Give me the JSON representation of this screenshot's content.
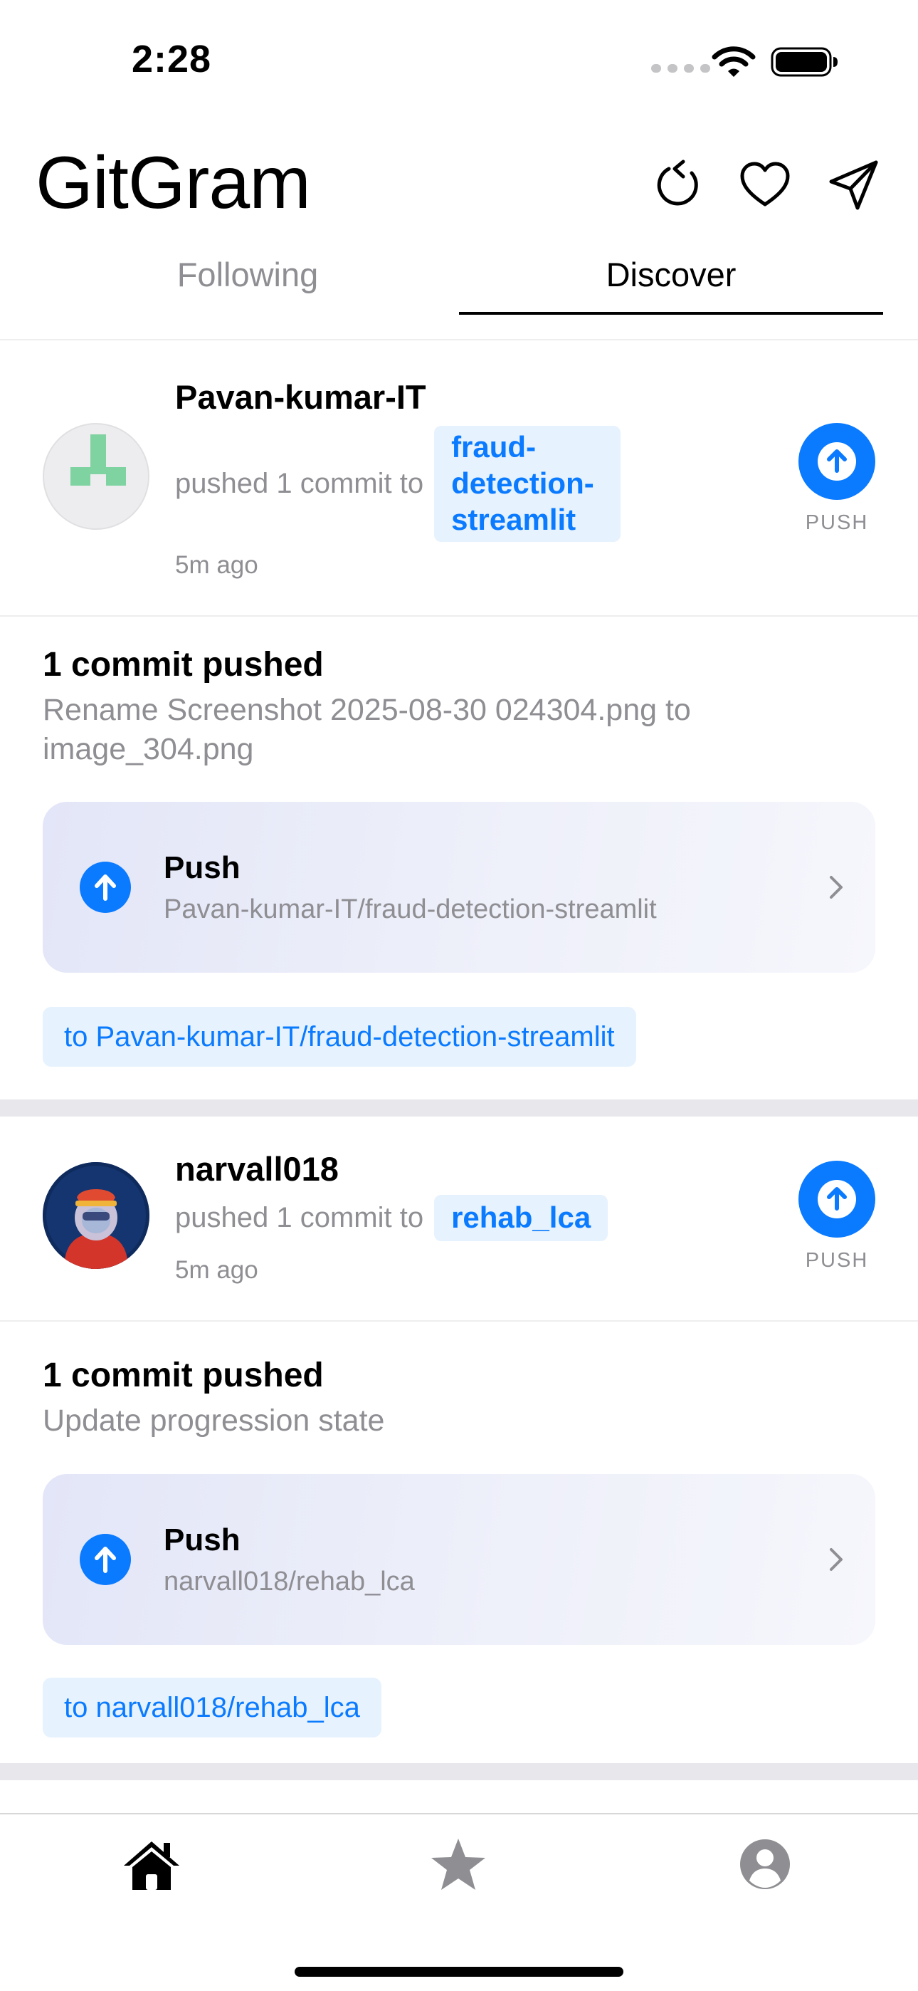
{
  "status_bar": {
    "time": "2:28"
  },
  "header": {
    "title": "GitGram"
  },
  "tabs": {
    "following": "Following",
    "discover": "Discover"
  },
  "posts": [
    {
      "username": "Pavan-kumar-IT",
      "action": "pushed 1 commit to",
      "repo_chip": "fraud-\ndetection-\nstreamlit",
      "time": "5m ago",
      "push_label": "PUSH",
      "commit_title": "1 commit pushed",
      "commit_message": "Rename Screenshot 2025-08-30 024304.png to image_304.png",
      "event_label": "Push",
      "event_repo": "Pavan-kumar-IT/fraud-detection-streamlit",
      "to_chip": "to Pavan-kumar-IT/fraud-detection-streamlit"
    },
    {
      "username": "narvall018",
      "action": "pushed 1 commit to",
      "repo_chip": "rehab_lca",
      "time": "5m ago",
      "push_label": "PUSH",
      "commit_title": "1 commit pushed",
      "commit_message": "Update progression state",
      "event_label": "Push",
      "event_repo": "narvall018/rehab_lca",
      "to_chip": "to narvall018/rehab_lca"
    }
  ],
  "icons": {
    "refresh": "refresh-icon",
    "heart": "heart-icon",
    "send": "send-icon",
    "push": "arrow-up-circle-icon",
    "chevron": "chevron-right-icon",
    "home": "home-icon",
    "star": "star-icon",
    "profile": "person-circle-icon"
  },
  "colors": {
    "accent": "#0a7aff",
    "secondary_text": "#8e8e93",
    "chip_bg": "#e6f2fe",
    "identicon": "#7fd3a0"
  }
}
